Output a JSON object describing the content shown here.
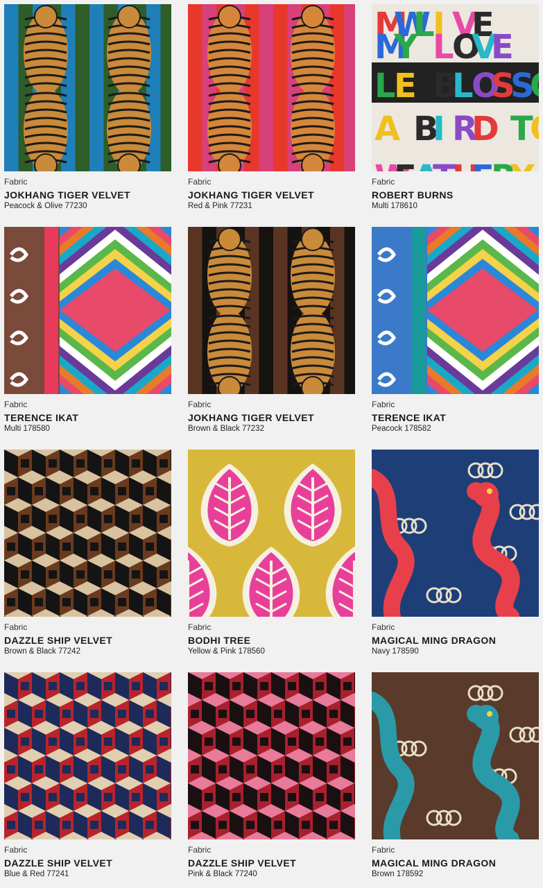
{
  "products": [
    {
      "category": "Fabric",
      "name": "JOKHANG TIGER VELVET",
      "color": "Peacock & Olive",
      "sku": "77230",
      "pattern": "tiger",
      "palette": {
        "bg1": "#1f7fb8",
        "bg2": "#2f5d2a",
        "fg": "#c98a3a"
      }
    },
    {
      "category": "Fabric",
      "name": "JOKHANG TIGER VELVET",
      "color": "Red & Pink",
      "sku": "77231",
      "pattern": "tiger",
      "palette": {
        "bg1": "#e8382c",
        "bg2": "#d8407a",
        "fg": "#d6863a"
      }
    },
    {
      "category": "Fabric",
      "name": "ROBERT BURNS",
      "color": "Multi",
      "sku": "178610",
      "pattern": "letters",
      "palette": {
        "bg1": "#ece8e0",
        "bg2": "#2a2a2a",
        "fg": "#e33"
      }
    },
    {
      "category": "Fabric",
      "name": "TERENCE IKAT",
      "color": "Multi",
      "sku": "178580",
      "pattern": "ikat",
      "palette": {
        "bg1": "#7a4a3a",
        "bg2": "#e83a5a",
        "fg": "#f4d24a"
      }
    },
    {
      "category": "Fabric",
      "name": "JOKHANG TIGER VELVET",
      "color": "Brown & Black",
      "sku": "77232",
      "pattern": "tiger",
      "palette": {
        "bg1": "#5a3422",
        "bg2": "#151210",
        "fg": "#c98a3a"
      }
    },
    {
      "category": "Fabric",
      "name": "TERENCE IKAT",
      "color": "Peacock",
      "sku": "178582",
      "pattern": "ikat",
      "palette": {
        "bg1": "#3a7ac8",
        "bg2": "#1a9a9a",
        "fg": "#d8d060"
      }
    },
    {
      "category": "Fabric",
      "name": "DAZZLE SHIP VELVET",
      "color": "Brown & Black",
      "sku": "77242",
      "pattern": "dazzle",
      "palette": {
        "bg1": "#6a3a1e",
        "bg2": "#141414",
        "fg": "#d8c2a0"
      }
    },
    {
      "category": "Fabric",
      "name": "BODHI TREE",
      "color": "Yellow & Pink",
      "sku": "178560",
      "pattern": "bodhi",
      "palette": {
        "bg1": "#d8b83a",
        "bg2": "#e8409a",
        "fg": "#f6f0e0"
      }
    },
    {
      "category": "Fabric",
      "name": "MAGICAL MING DRAGON",
      "color": "Navy",
      "sku": "178590",
      "pattern": "dragon",
      "palette": {
        "bg1": "#1e3e78",
        "bg2": "#e8404a",
        "fg": "#e8e0c8"
      }
    },
    {
      "category": "Fabric",
      "name": "DAZZLE SHIP VELVET",
      "color": "Blue & Red",
      "sku": "77241",
      "pattern": "dazzle",
      "palette": {
        "bg1": "#b8242a",
        "bg2": "#1e2a5a",
        "fg": "#e0cfb0"
      }
    },
    {
      "category": "Fabric",
      "name": "DAZZLE SHIP VELVET",
      "color": "Pink & Black",
      "sku": "77240",
      "pattern": "dazzle",
      "palette": {
        "bg1": "#a8202e",
        "bg2": "#1a1012",
        "fg": "#e87a9a"
      }
    },
    {
      "category": "Fabric",
      "name": "MAGICAL MING DRAGON",
      "color": "Brown",
      "sku": "178592",
      "pattern": "dragon",
      "palette": {
        "bg1": "#5a3a2a",
        "bg2": "#2a9aa8",
        "fg": "#e8e0c8"
      }
    }
  ]
}
